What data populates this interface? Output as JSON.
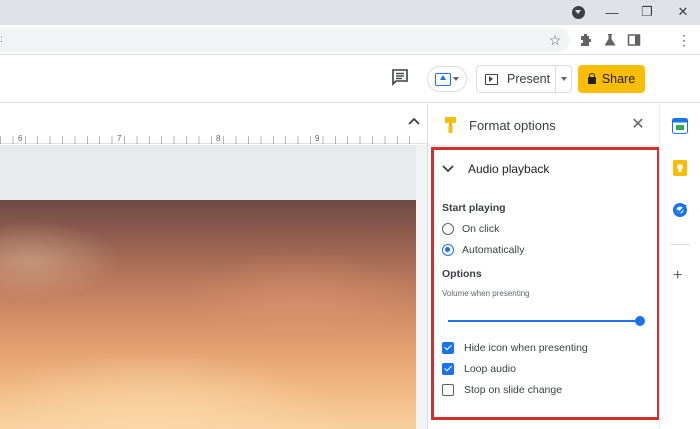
{
  "browser": {
    "window_controls": {
      "minimize": "—",
      "restore": "❐",
      "close": "✕"
    },
    "toolbar_icons": [
      "star-icon",
      "extensions-icon",
      "labs-icon",
      "side-panel-icon",
      "menu-icon"
    ]
  },
  "header": {
    "present_label": "Present",
    "share_label": "Share"
  },
  "ruler": {
    "marks": [
      "6",
      "7",
      "8",
      "9"
    ]
  },
  "panel": {
    "title": "Format options",
    "section_title": "Audio playback",
    "start_playing_label": "Start playing",
    "start_options": [
      {
        "label": "On click",
        "selected": false
      },
      {
        "label": "Automatically",
        "selected": true
      }
    ],
    "options_label": "Options",
    "volume_label": "Volume when presenting",
    "volume_level": 1.0,
    "checkboxes": [
      {
        "label": "Hide icon when presenting",
        "checked": true
      },
      {
        "label": "Loop audio",
        "checked": true
      },
      {
        "label": "Stop on slide change",
        "checked": false
      }
    ]
  },
  "addons": [
    {
      "name": "calendar-icon",
      "color": "#1a73e8"
    },
    {
      "name": "keep-icon",
      "color": "#fbbc04"
    },
    {
      "name": "tasks-icon",
      "color": "#1a73e8"
    }
  ],
  "colors": {
    "accent": "#1a73e8",
    "share": "#fbbc04",
    "highlight": "#d32f2f"
  }
}
